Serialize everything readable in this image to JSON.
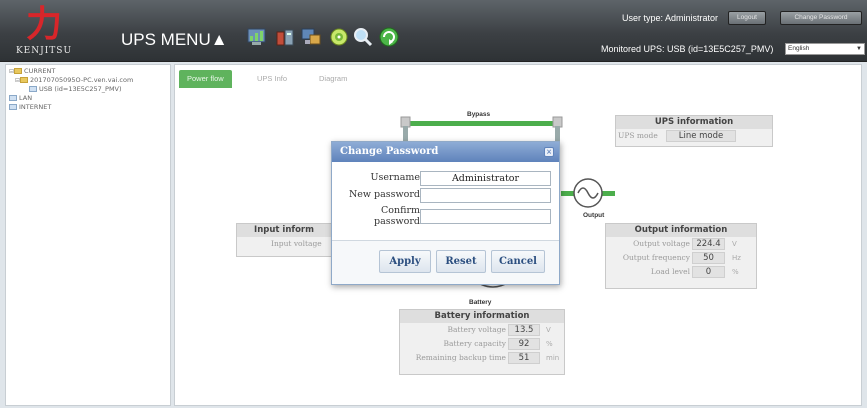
{
  "header": {
    "logo_glyph": "力",
    "logo_text": "KENJITSU",
    "menu_title": "UPS MENU▲",
    "toolbar_icons": [
      "chart-icon",
      "battery-pack-icon",
      "monitor-network-icon",
      "cd-icon",
      "search-icon",
      "refresh-icon"
    ],
    "user_type": "User type: Administrator",
    "logout_label": "Logout",
    "change_password_label": "Change Password",
    "monitored_ups": "Monitored UPS: USB (id=13E5C257_PMV)",
    "language": "English"
  },
  "sidebar": {
    "items": [
      {
        "label": "CURRENT"
      },
      {
        "label": "20170705095O-PC.ven.vai.com"
      },
      {
        "label": "USB (id=13E5C257_PMV)"
      },
      {
        "label": "LAN"
      },
      {
        "label": "INTERNET"
      }
    ]
  },
  "tabs": [
    {
      "label": "Power flow"
    },
    {
      "label": "UPS Info"
    },
    {
      "label": "Diagram"
    }
  ],
  "diagram": {
    "bypass_label": "Bypass",
    "output_label": "Output",
    "battery_label": "Battery"
  },
  "ups_info": {
    "title": "UPS information",
    "mode_label": "UPS mode",
    "mode_value": "Line mode"
  },
  "input_info": {
    "title": "Input inform",
    "voltage_label": "Input voltage"
  },
  "output_info": {
    "title": "Output information",
    "voltage_label": "Output voltage",
    "voltage_value": "224.4",
    "voltage_unit": "V",
    "frequency_label": "Output frequency",
    "frequency_value": "50",
    "frequency_unit": "Hz",
    "load_label": "Load level",
    "load_value": "0",
    "load_unit": "%"
  },
  "battery_info": {
    "title": "Battery information",
    "voltage_label": "Battery voltage",
    "voltage_value": "13.5",
    "voltage_unit": "V",
    "capacity_label": "Battery capacity",
    "capacity_value": "92",
    "capacity_unit": "%",
    "backup_label": "Remaining backup time",
    "backup_value": "51",
    "backup_unit": "min"
  },
  "modal": {
    "title": "Change Password",
    "username_label": "Username",
    "username_value": "Administrator",
    "new_password_label": "New password",
    "confirm_label_line1": "Confirm",
    "confirm_label_line2": "password",
    "apply_label": "Apply",
    "reset_label": "Reset",
    "cancel_label": "Cancel"
  },
  "colors": {
    "accent_green": "#5fb35d",
    "flow_green": "#4cae4c",
    "modal_header": "#5f83bb",
    "logo_red": "#d8262a"
  }
}
